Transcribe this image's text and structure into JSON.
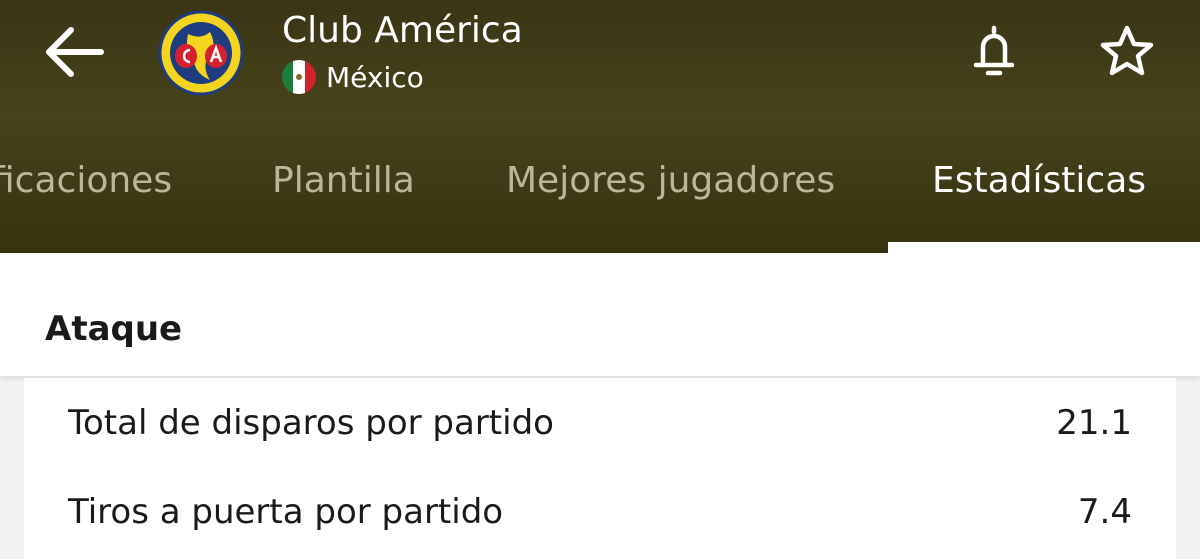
{
  "header": {
    "team_name": "Club América",
    "country": "México",
    "colors": {
      "accent": "#ffffff",
      "background": "#403c17",
      "inactive_tab": "#bdb69a",
      "crest_yellow": "#f4d41e",
      "crest_blue": "#1e3c80",
      "crest_red": "#d4212e"
    }
  },
  "tabs": [
    {
      "label": "ficaciones"
    },
    {
      "label": "Plantilla"
    },
    {
      "label": "Mejores jugadores"
    },
    {
      "label": "Estadísticas"
    }
  ],
  "section": {
    "title": "Ataque"
  },
  "stats": [
    {
      "label": "Total de disparos por partido",
      "value": "21.1"
    },
    {
      "label": "Tiros a puerta por partido",
      "value": "7.4"
    }
  ]
}
